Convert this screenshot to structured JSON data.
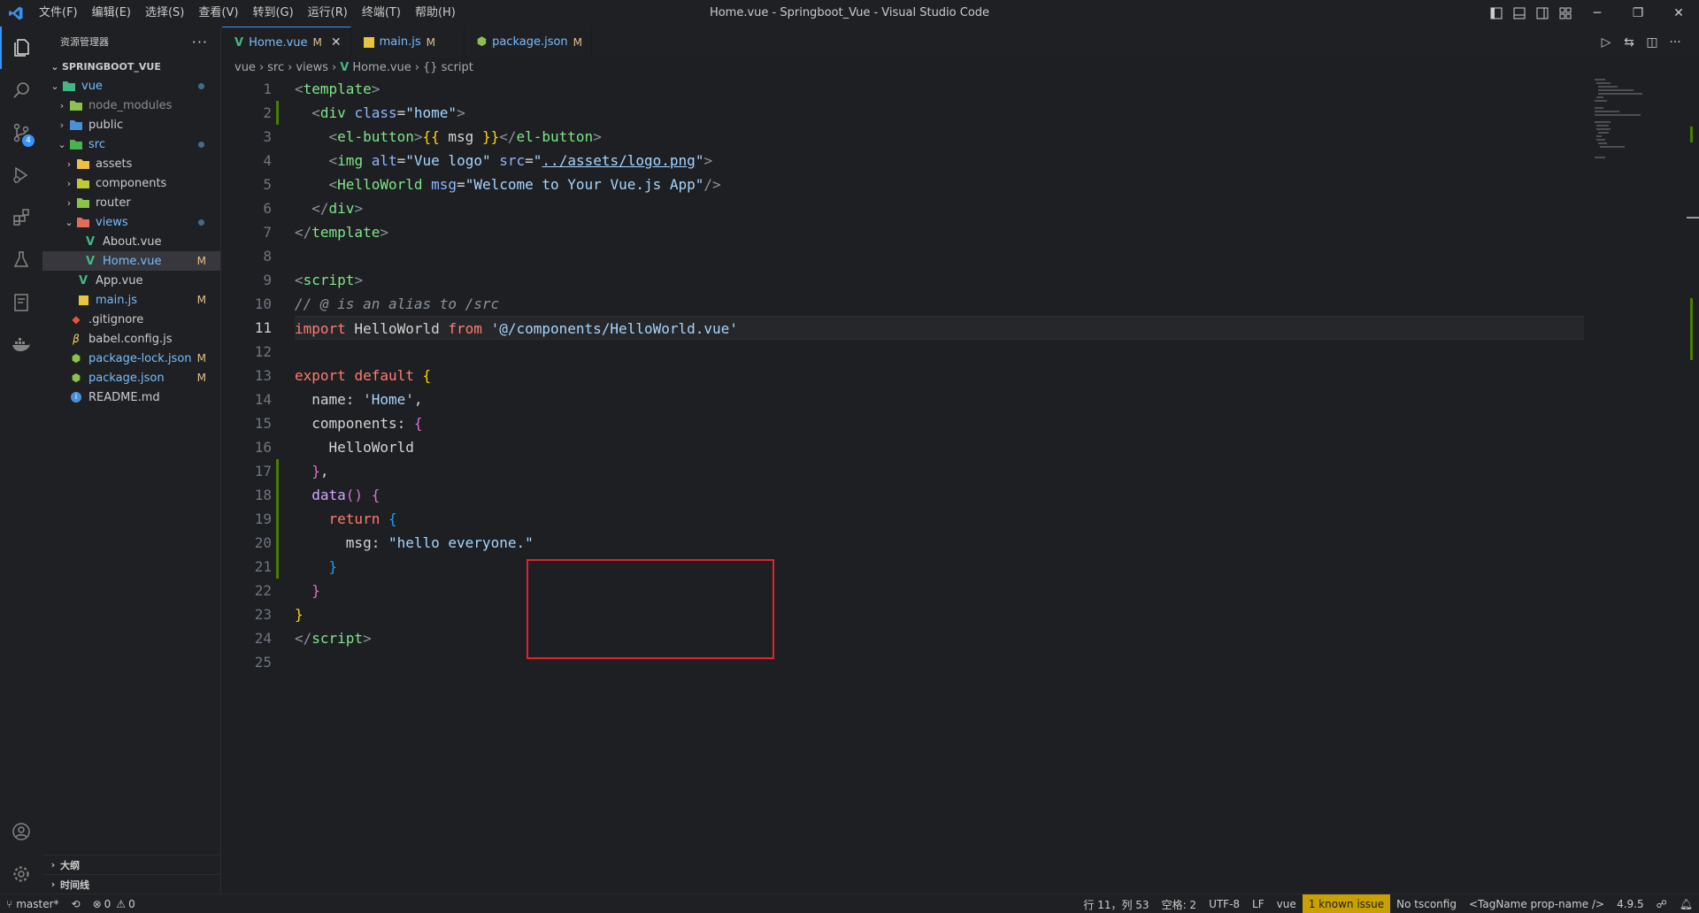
{
  "window": {
    "title": "Home.vue - Springboot_Vue - Visual Studio Code",
    "menu": [
      "文件(F)",
      "编辑(E)",
      "选择(S)",
      "查看(V)",
      "转到(G)",
      "运行(R)",
      "终端(T)",
      "帮助(H)"
    ]
  },
  "activity_bar": {
    "items": [
      "files-icon",
      "search-icon",
      "source-control-icon",
      "run-debug-icon",
      "extensions-icon",
      "testing-icon",
      "remote-explorer-icon",
      "docker-icon"
    ],
    "scm_badge": "4",
    "bottom": [
      "account-icon",
      "settings-gear-icon"
    ]
  },
  "sidebar": {
    "title": "资源管理器",
    "more": "···",
    "project": "SPRINGBOOT_VUE",
    "tree": [
      {
        "label": "vue",
        "depth": 1,
        "type": "folder",
        "open": true,
        "color": "blue",
        "dot": true
      },
      {
        "label": "node_modules",
        "depth": 2,
        "type": "folder",
        "open": false,
        "color": "gray"
      },
      {
        "label": "public",
        "depth": 2,
        "type": "folder",
        "open": false,
        "color": "norm"
      },
      {
        "label": "src",
        "depth": 2,
        "type": "folder",
        "open": true,
        "color": "blue",
        "dot": true
      },
      {
        "label": "assets",
        "depth": 3,
        "type": "folder",
        "open": false,
        "color": "norm"
      },
      {
        "label": "components",
        "depth": 3,
        "type": "folder",
        "open": false,
        "color": "norm"
      },
      {
        "label": "router",
        "depth": 3,
        "type": "folder",
        "open": false,
        "color": "norm"
      },
      {
        "label": "views",
        "depth": 3,
        "type": "folder",
        "open": true,
        "color": "blue",
        "dot": true
      },
      {
        "label": "About.vue",
        "depth": 4,
        "type": "vue",
        "color": "norm"
      },
      {
        "label": "Home.vue",
        "depth": 4,
        "type": "vue",
        "color": "blue",
        "flag": "M",
        "selected": true
      },
      {
        "label": "App.vue",
        "depth": 3,
        "type": "vue",
        "color": "norm"
      },
      {
        "label": "main.js",
        "depth": 3,
        "type": "js",
        "color": "blue",
        "flag": "M"
      },
      {
        "label": ".gitignore",
        "depth": 2,
        "type": "git",
        "color": "norm"
      },
      {
        "label": "babel.config.js",
        "depth": 2,
        "type": "babel",
        "color": "norm"
      },
      {
        "label": "package-lock.json",
        "depth": 2,
        "type": "json",
        "color": "blue",
        "flag": "M"
      },
      {
        "label": "package.json",
        "depth": 2,
        "type": "json",
        "color": "blue",
        "flag": "M"
      },
      {
        "label": "README.md",
        "depth": 2,
        "type": "info",
        "color": "norm"
      }
    ],
    "sections": [
      "大纲",
      "时间线"
    ]
  },
  "tabs": [
    {
      "label": "Home.vue",
      "flag": "M",
      "active": true,
      "icon": "vue-icon"
    },
    {
      "label": "main.js",
      "flag": "M",
      "active": false,
      "icon": "js-icon"
    },
    {
      "label": "package.json",
      "flag": "M",
      "active": false,
      "icon": "json-icon"
    }
  ],
  "breadcrumb": [
    "vue",
    "src",
    "views",
    "Home.vue",
    "{} script"
  ],
  "editor": {
    "current_line": 11,
    "line_numbers": [
      "1",
      "2",
      "3",
      "4",
      "5",
      "6",
      "7",
      "8",
      "9",
      "10",
      "11",
      "12",
      "13",
      "14",
      "15",
      "16",
      "17",
      "18",
      "19",
      "20",
      "21",
      "22",
      "23",
      "24",
      "25"
    ],
    "highlight_box": {
      "from_line": 18,
      "to_line": 21
    }
  },
  "status": {
    "branch": "master*",
    "errors": "0",
    "warnings": "0",
    "position": "行 11，列 53",
    "spaces": "空格: 2",
    "encoding": "UTF-8",
    "eol": "LF",
    "language": "vue",
    "issue": "1 known issue",
    "tsconfig": "No tsconfig",
    "tag_mode": "<TagName prop-name />",
    "version": "4.9.5"
  }
}
